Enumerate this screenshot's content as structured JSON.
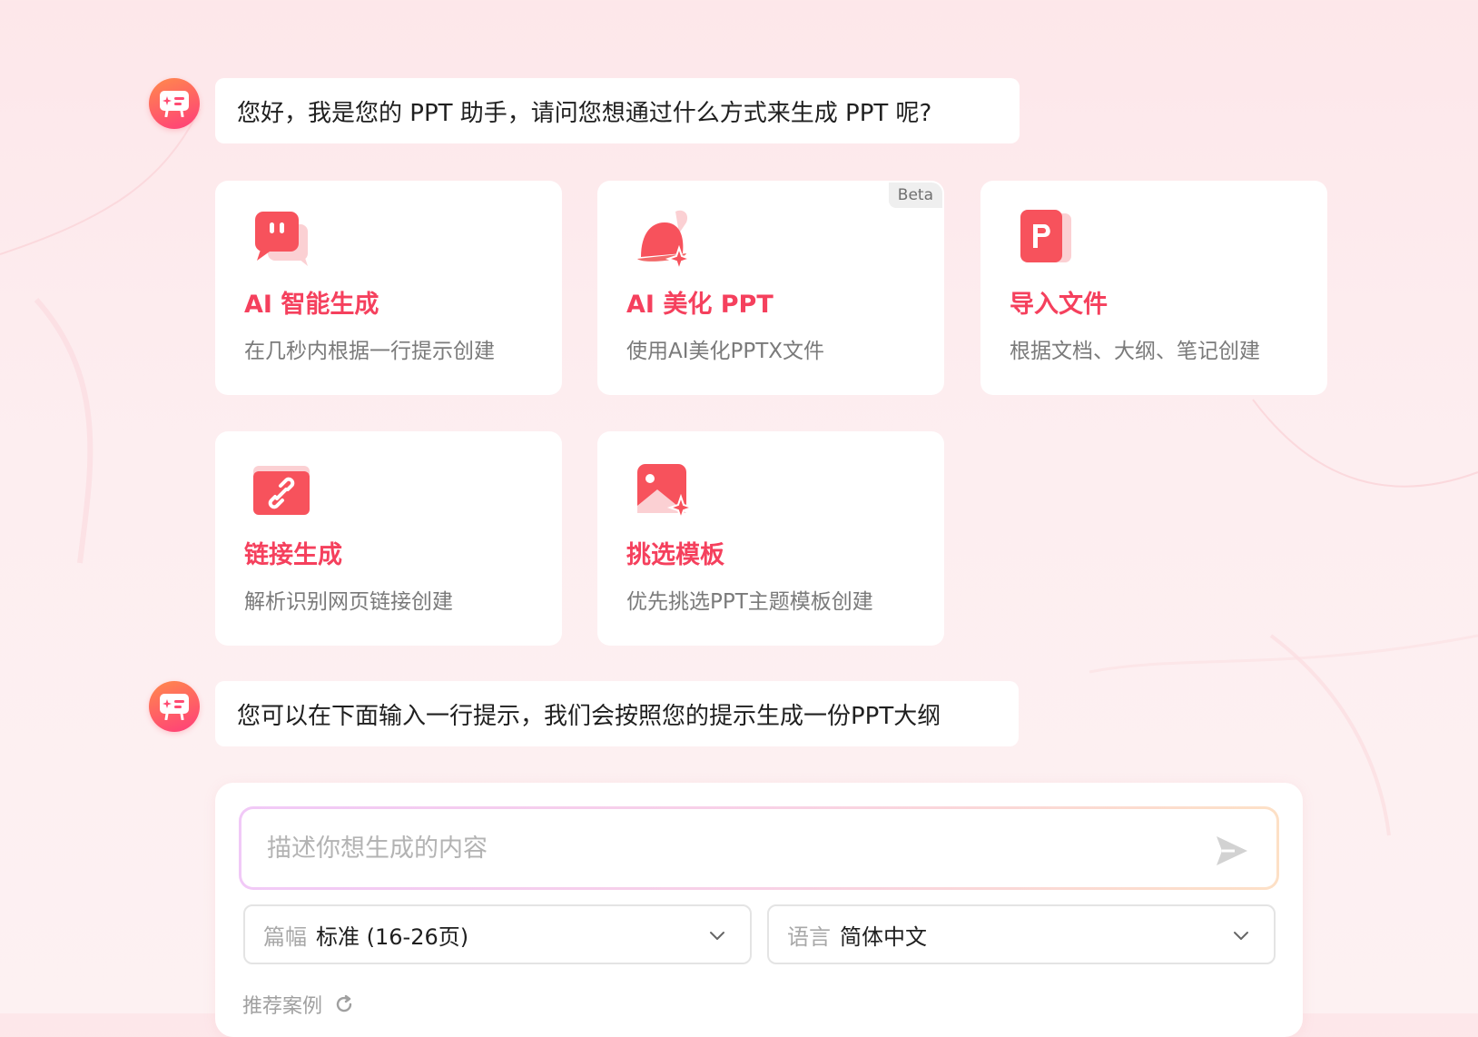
{
  "messages": [
    {
      "text": "您好，我是您的 PPT 助手，请问您想通过什么方式来生成 PPT 呢?"
    },
    {
      "text": "您可以在下面输入一行提示，我们会按照您的提示生成一份PPT大纲"
    }
  ],
  "options": [
    {
      "title": "AI 智能生成",
      "desc": "在几秒内根据一行提示创建",
      "icon": "chat-bubble-icon"
    },
    {
      "title": "AI 美化 PPT",
      "desc": "使用AI美化PPTX文件",
      "icon": "bell-sparkle-icon",
      "badge": "Beta"
    },
    {
      "title": "导入文件",
      "desc": "根据文档、大纲、笔记创建",
      "icon": "ppt-file-icon"
    },
    {
      "title": "链接生成",
      "desc": "解析识别网页链接创建",
      "icon": "link-icon"
    },
    {
      "title": "挑选模板",
      "desc": "优先挑选PPT主题模板创建",
      "icon": "image-sparkle-icon"
    }
  ],
  "input": {
    "placeholder": "描述你想生成的内容",
    "value": ""
  },
  "length_select": {
    "label": "篇幅",
    "value": "标准 (16-26页)"
  },
  "language_select": {
    "label": "语言",
    "value": "简体中文"
  },
  "recommend": {
    "label": "推荐案例"
  },
  "colors": {
    "accent": "#f5405d",
    "avatar_start": "#ff8a4c",
    "avatar_end": "#ff3d7a"
  }
}
